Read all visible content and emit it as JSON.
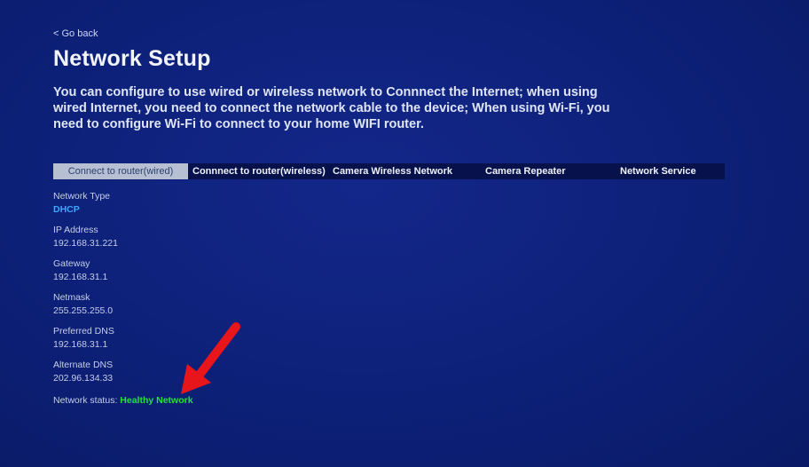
{
  "header": {
    "back_label": "< Go back",
    "title": "Network Setup",
    "description": "You can configure to use wired or wireless network to Connnect the Internet; when using wired Internet, you need to connect the network cable to the device; When using Wi-Fi, you need to configure Wi-Fi to connect to your home WIFI router."
  },
  "tabs": [
    {
      "label": "Connect to router(wired)",
      "active": true
    },
    {
      "label": "Connnect to router(wireless)",
      "active": false
    },
    {
      "label": "Camera Wireless Network",
      "active": false
    },
    {
      "label": "Camera Repeater",
      "active": false
    },
    {
      "label": "Network Service",
      "active": false
    }
  ],
  "network_info": [
    {
      "label": "Network Type",
      "value": "DHCP"
    },
    {
      "label": "IP Address",
      "value": "192.168.31.221"
    },
    {
      "label": "Gateway",
      "value": "192.168.31.1"
    },
    {
      "label": "Netmask",
      "value": "255.255.255.0"
    },
    {
      "label": "Preferred DNS",
      "value": "192.168.31.1"
    },
    {
      "label": "Alternate DNS",
      "value": "202.96.134.33"
    }
  ],
  "status": {
    "label": "Network status:",
    "value": "Healthy Network"
  },
  "colors": {
    "background": "#0c1f73",
    "tab_bar": "#07124d",
    "active_tab": "#b7c0d3",
    "network_type_value": "#3aa8ff",
    "status_ok": "#23e23a",
    "annotation_arrow": "#e8161b"
  }
}
